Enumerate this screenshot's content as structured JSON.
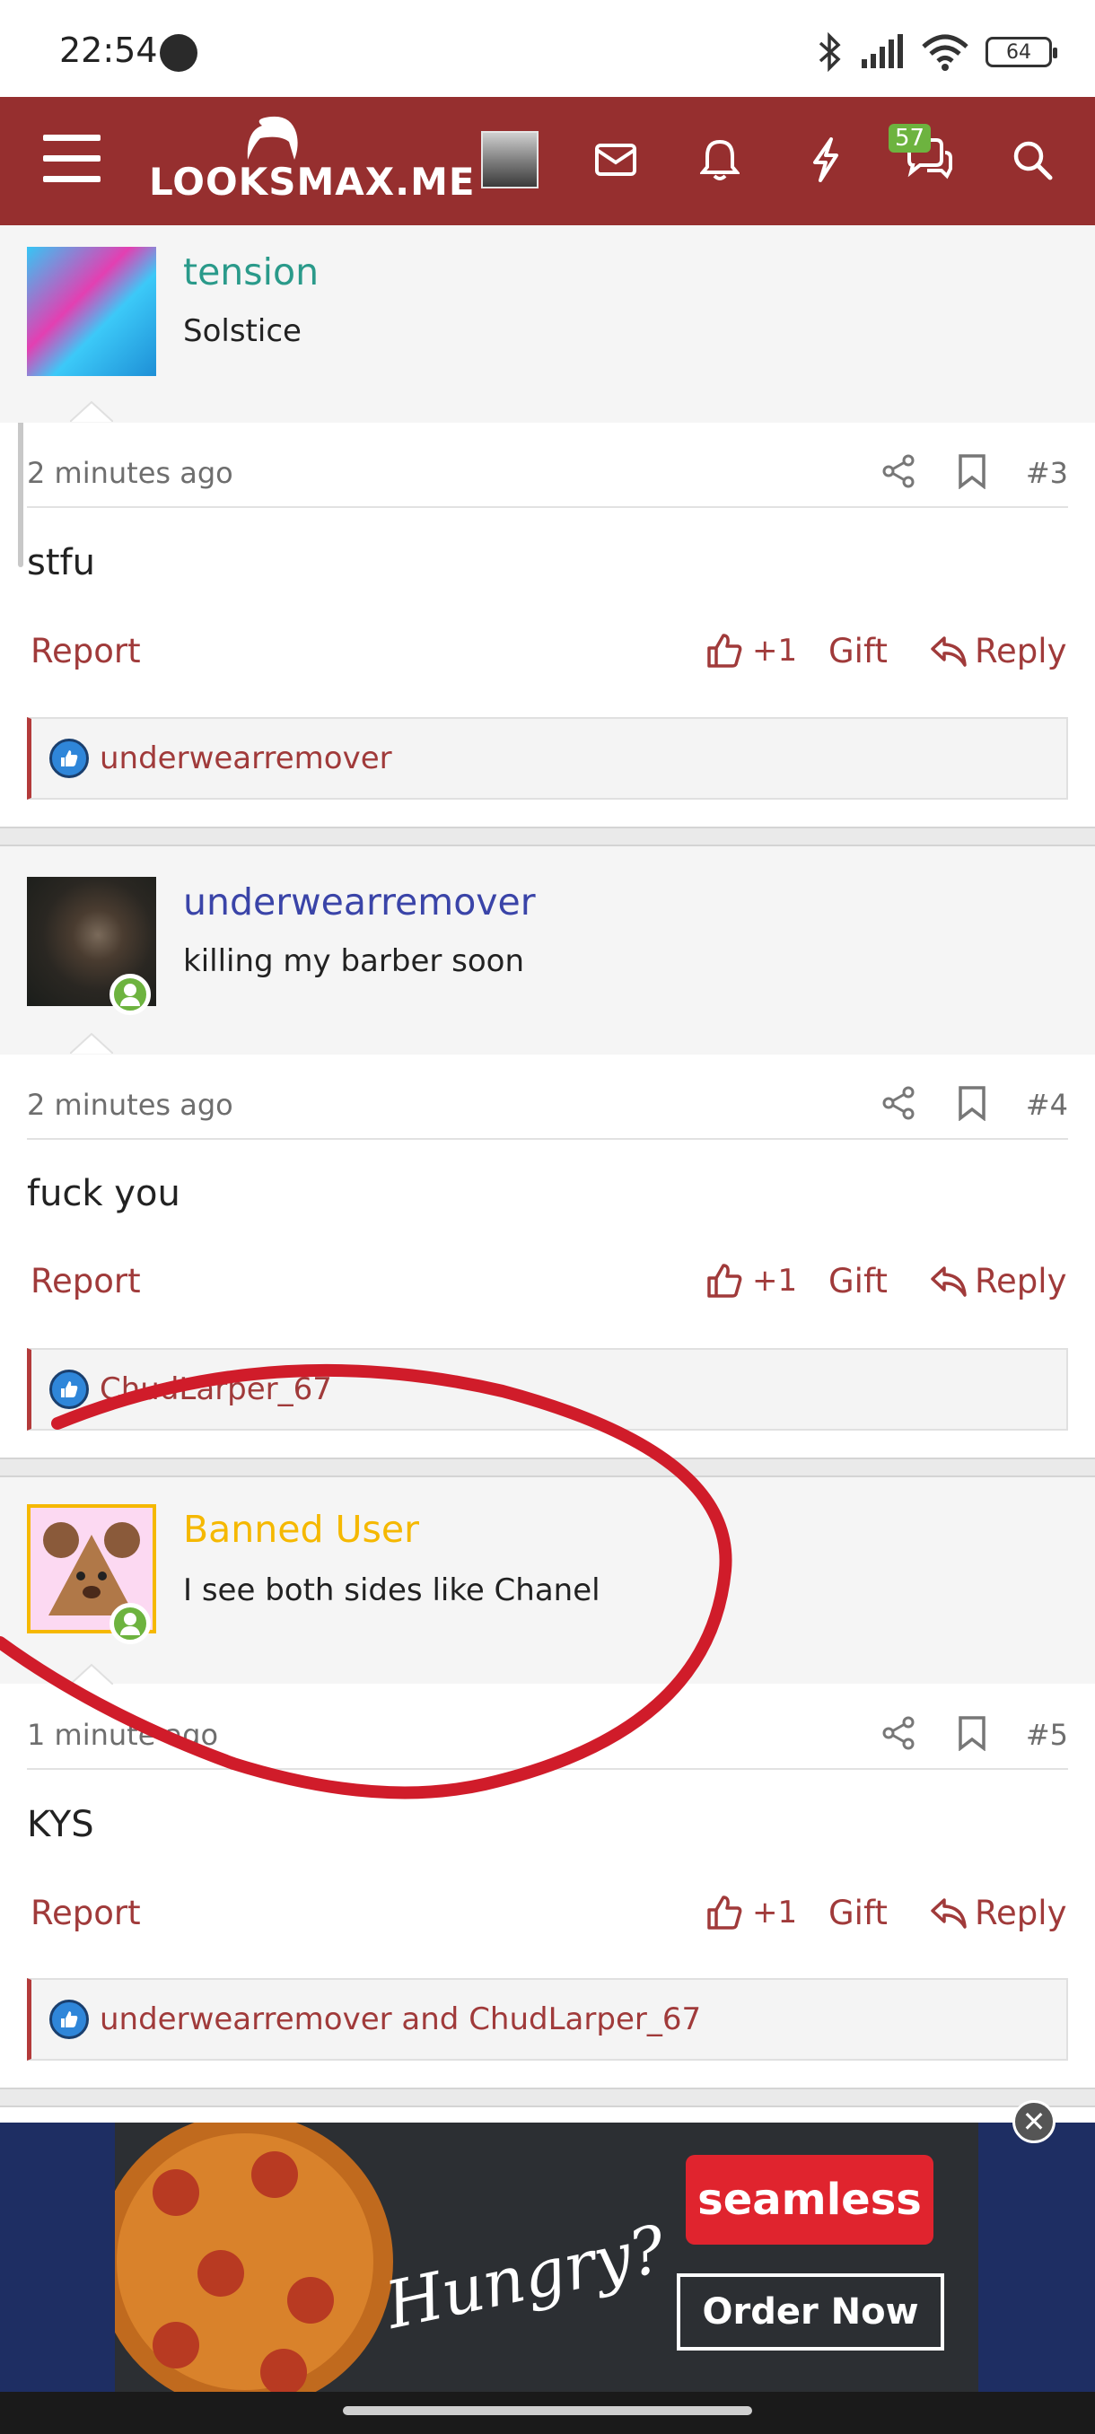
{
  "status_bar": {
    "time": "22:54",
    "battery": "64"
  },
  "header": {
    "logo": "LOOKSMAX.ME",
    "conversations_badge": "57"
  },
  "posts": [
    {
      "username": "tension",
      "username_color": "#2a9a8a",
      "user_title": "Solstice",
      "time": "2 minutes ago",
      "post_number": "#3",
      "content": "stfu",
      "reactions": "underwearremover"
    },
    {
      "username": "underwearremover",
      "username_color": "#3a44a8",
      "user_title": "killing my barber soon",
      "time": "2 minutes ago",
      "post_number": "#4",
      "content": "fuck you",
      "reactions": "ChudLarper_67"
    },
    {
      "username": "Banned User",
      "username_color": "#f5b800",
      "user_title": "I see both sides like Chanel",
      "time": "1 minute ago",
      "post_number": "#5",
      "content": "KYS",
      "reactions": "underwearremover and ChudLarper_67"
    }
  ],
  "actions": {
    "report": "Report",
    "like": "+1",
    "gift": "Gift",
    "reply": "Reply"
  },
  "ad": {
    "headline": "Hungry?",
    "brand": "seamless",
    "cta": "Order Now",
    "close": "✕"
  },
  "colors": {
    "header_bg": "#962f2f",
    "link": "#a03a3a",
    "online": "#6db33f",
    "annotation": "#d01c2a"
  }
}
